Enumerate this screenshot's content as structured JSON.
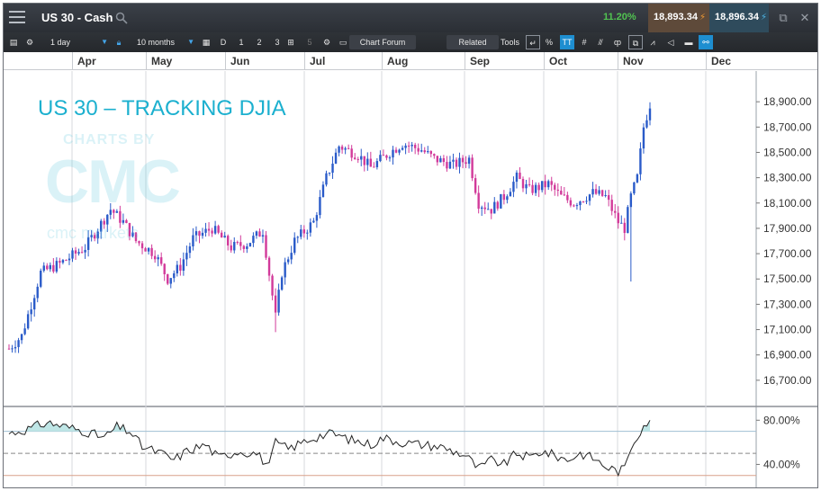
{
  "window": {
    "instrument": "US 30 - Cash",
    "change_pct": "11.20%",
    "sell_price": "18,893.34",
    "buy_price": "18,896.34",
    "sell_arrow_icon": "down-arrow-icon",
    "buy_arrow_icon": "up-arrow-icon"
  },
  "toolbar": {
    "interval": "1 day",
    "range": "10 months",
    "period_buttons": [
      "D",
      "1",
      "2",
      "3"
    ],
    "disabled_count": "5",
    "chart_forum_label": "Chart Forum",
    "related_label": "Related",
    "tools_label": "Tools",
    "percent_label": "%",
    "text_tool_label": "TT"
  },
  "chart_overlay": {
    "title": "US 30 – TRACKING DJIA",
    "watermark_by": "CHARTS BY",
    "watermark_logo": "CMC",
    "watermark_sub": "cmc markets"
  },
  "chart_data": [
    {
      "type": "candlestick",
      "x_axis": {
        "labels": [
          "Apr",
          "May",
          "Jun",
          "Jul",
          "Aug",
          "Sep",
          "Oct",
          "Nov",
          "Dec"
        ]
      },
      "y_axis": {
        "ylim": [
          16500,
          19100
        ],
        "tick_labels": [
          "18,900.00",
          "18,700.00",
          "18,500.00",
          "18,300.00",
          "18,100.00",
          "17,900.00",
          "17,700.00",
          "17,500.00",
          "17,300.00",
          "17,100.00",
          "16,900.00",
          "16,700.00"
        ],
        "ticks": [
          18900,
          18700,
          18500,
          18300,
          18100,
          17900,
          17700,
          17500,
          17300,
          17100,
          16900,
          16700
        ]
      },
      "series": [
        {
          "trend_anchors": [
            [
              0,
              16950
            ],
            [
              4,
              17050
            ],
            [
              10,
              17550
            ],
            [
              16,
              17620
            ],
            [
              24,
              17750
            ],
            [
              28,
              17900
            ],
            [
              32,
              18050
            ],
            [
              36,
              17950
            ],
            [
              40,
              17800
            ],
            [
              46,
              17700
            ],
            [
              50,
              17500
            ],
            [
              54,
              17600
            ],
            [
              58,
              17820
            ],
            [
              64,
              17900
            ],
            [
              70,
              17750
            ],
            [
              75,
              17780
            ],
            [
              80,
              17880
            ],
            [
              84,
              17200
            ],
            [
              86,
              17550
            ],
            [
              90,
              17800
            ],
            [
              96,
              17950
            ],
            [
              100,
              18300
            ],
            [
              104,
              18550
            ],
            [
              110,
              18480
            ],
            [
              114,
              18380
            ],
            [
              120,
              18500
            ],
            [
              124,
              18570
            ],
            [
              130,
              18520
            ],
            [
              134,
              18450
            ],
            [
              140,
              18400
            ],
            [
              145,
              18450
            ],
            [
              148,
              18100
            ],
            [
              152,
              18050
            ],
            [
              156,
              18150
            ],
            [
              160,
              18300
            ],
            [
              164,
              18200
            ],
            [
              170,
              18250
            ],
            [
              174,
              18150
            ],
            [
              178,
              18100
            ],
            [
              184,
              18180
            ],
            [
              188,
              18150
            ],
            [
              192,
              17950
            ],
            [
              194,
              17900
            ],
            [
              196,
              18150
            ],
            [
              198,
              18300
            ],
            [
              200,
              18700
            ],
            [
              202,
              18880
            ]
          ],
          "bars": 203
        }
      ]
    },
    {
      "type": "line",
      "indicator": "oscillator",
      "y_axis": {
        "tick_labels": [
          "80.00%",
          "40.00%"
        ],
        "ticks": [
          80,
          40
        ],
        "ylim": [
          20,
          90
        ]
      },
      "reference_levels": [
        70,
        50,
        30
      ],
      "series": [
        {
          "points": [
            [
              0,
              68
            ],
            [
              6,
              72
            ],
            [
              12,
              78
            ],
            [
              18,
              74
            ],
            [
              24,
              70
            ],
            [
              30,
              64
            ],
            [
              34,
              74
            ],
            [
              38,
              70
            ],
            [
              42,
              56
            ],
            [
              48,
              50
            ],
            [
              52,
              44
            ],
            [
              56,
              52
            ],
            [
              62,
              58
            ],
            [
              66,
              46
            ],
            [
              72,
              52
            ],
            [
              78,
              50
            ],
            [
              82,
              38
            ],
            [
              84,
              60
            ],
            [
              88,
              54
            ],
            [
              94,
              62
            ],
            [
              98,
              66
            ],
            [
              102,
              68
            ],
            [
              108,
              62
            ],
            [
              114,
              58
            ],
            [
              118,
              64
            ],
            [
              124,
              60
            ],
            [
              130,
              58
            ],
            [
              136,
              56
            ],
            [
              140,
              52
            ],
            [
              144,
              48
            ],
            [
              148,
              36
            ],
            [
              152,
              44
            ],
            [
              156,
              40
            ],
            [
              160,
              50
            ],
            [
              164,
              46
            ],
            [
              168,
              52
            ],
            [
              172,
              48
            ],
            [
              176,
              44
            ],
            [
              180,
              50
            ],
            [
              184,
              46
            ],
            [
              188,
              38
            ],
            [
              192,
              34
            ],
            [
              194,
              36
            ],
            [
              196,
              56
            ],
            [
              198,
              66
            ],
            [
              200,
              76
            ],
            [
              202,
              80
            ]
          ]
        }
      ]
    }
  ],
  "colors": {
    "up_candle": "#2a5bc9",
    "down_candle": "#d23a9a",
    "axis_text": "#333333",
    "overlay_title": "#1cb0cf",
    "change_positive": "#51c451",
    "active_tool": "#1e8ed0"
  }
}
